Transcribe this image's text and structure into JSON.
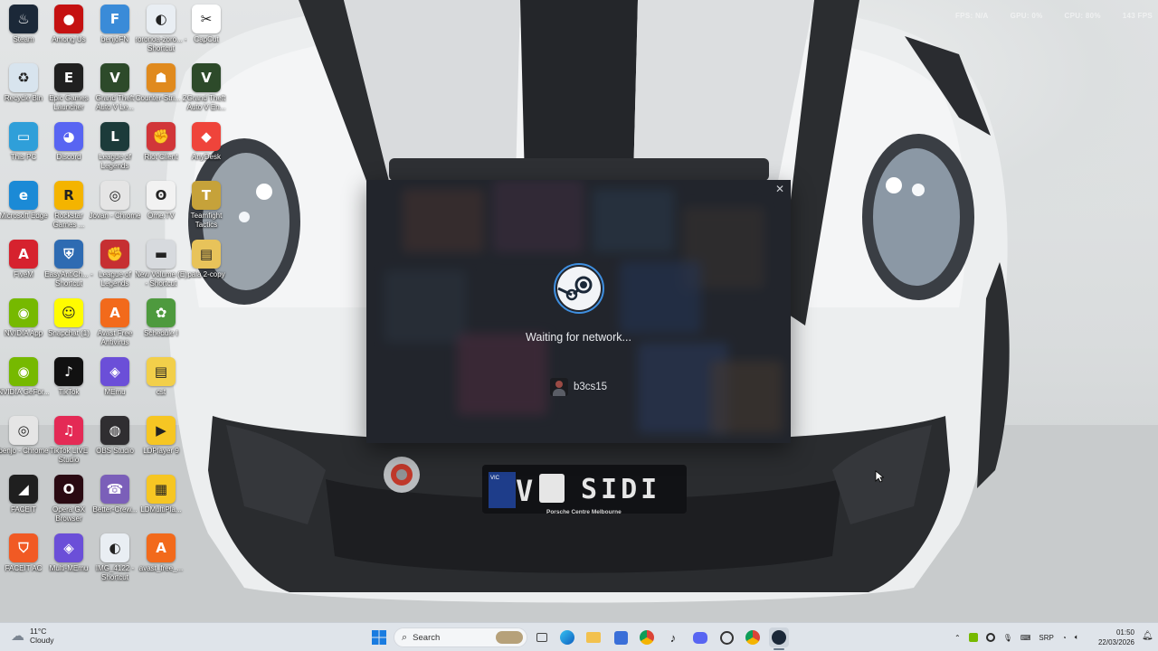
{
  "status_overlay": [
    "FPS: N/A",
    "GPU: 0%",
    "CPU: 80%",
    "143 FPS"
  ],
  "desktop_icons": [
    {
      "label": "Steam",
      "icon": "steam-icon",
      "color": "#1b2838",
      "glyph": "♨"
    },
    {
      "label": "Among Us",
      "icon": "among-us-icon",
      "color": "#c51111",
      "glyph": "●"
    },
    {
      "label": "benjoFN",
      "icon": "fortnite-icon",
      "color": "#3a8bd8",
      "glyph": "F"
    },
    {
      "label": "roronoa-zoro... - Shortcut",
      "icon": "image-shortcut-icon",
      "color": "#e9eef3",
      "glyph": "◐"
    },
    {
      "label": "CapCut",
      "icon": "capcut-icon",
      "color": "#ffffff",
      "glyph": "✂"
    },
    {
      "label": "Recycle Bin",
      "icon": "recycle-bin-icon",
      "color": "#d8e4ee",
      "glyph": "♻"
    },
    {
      "label": "Epic Games Launcher",
      "icon": "epic-games-icon",
      "color": "#202020",
      "glyph": "E"
    },
    {
      "label": "Grand Theft Auto V Le...",
      "icon": "gta-v-icon",
      "color": "#2d4a2a",
      "glyph": "V"
    },
    {
      "label": "Counter-Stri... 2",
      "icon": "counter-strike-icon",
      "color": "#e08a1e",
      "glyph": "☗"
    },
    {
      "label": "Grand Theft Auto V En...",
      "icon": "gta-v-enhanced-icon",
      "color": "#2d4a2a",
      "glyph": "V"
    },
    {
      "label": "This PC",
      "icon": "this-pc-icon",
      "color": "#2f9fd9",
      "glyph": "▭"
    },
    {
      "label": "Discord",
      "icon": "discord-icon",
      "color": "#5865f2",
      "glyph": "◕"
    },
    {
      "label": "League of Legends",
      "icon": "league-icon",
      "color": "#1c3b3a",
      "glyph": "L"
    },
    {
      "label": "Riot Client",
      "icon": "riot-client-icon",
      "color": "#d13639",
      "glyph": "✊"
    },
    {
      "label": "AnyDesk",
      "icon": "anydesk-icon",
      "color": "#ef443b",
      "glyph": "◆"
    },
    {
      "label": "Microsoft Edge",
      "icon": "edge-icon",
      "color": "#1b8ad6",
      "glyph": "e"
    },
    {
      "label": "Rockstar Games ...",
      "icon": "rockstar-icon",
      "color": "#f4b400",
      "glyph": "R"
    },
    {
      "label": "Jovan - Chrome",
      "icon": "chrome-icon",
      "color": "#e5e5e5",
      "glyph": "◎"
    },
    {
      "label": "Ome.TV",
      "icon": "ometv-icon",
      "color": "#f2f2f2",
      "glyph": "ʘ"
    },
    {
      "label": "Teamfight Tactics",
      "icon": "tft-icon",
      "color": "#c6a23a",
      "glyph": "T"
    },
    {
      "label": "FiveM",
      "icon": "fivem-icon",
      "color": "#d6222e",
      "glyph": "A"
    },
    {
      "label": "EasyAntiCh... - Shortcut",
      "icon": "easyanticheat-icon",
      "color": "#2e6bb2",
      "glyph": "⛨"
    },
    {
      "label": "League of Legends",
      "icon": "league-riot-icon",
      "color": "#c62f32",
      "glyph": "✊"
    },
    {
      "label": "New Volume (E) - Shortcut",
      "icon": "drive-icon",
      "color": "#d7dade",
      "glyph": "▬"
    },
    {
      "label": "pala 2-copy",
      "icon": "folder-icon",
      "color": "#e8c35a",
      "glyph": "▤"
    },
    {
      "label": "NVIDIA App",
      "icon": "nvidia-icon",
      "color": "#76b900",
      "glyph": "◉"
    },
    {
      "label": "Snapchat (1)",
      "icon": "snapchat-icon",
      "color": "#fffc00",
      "glyph": "☺"
    },
    {
      "label": "Avast Free Antivirus",
      "icon": "avast-icon",
      "color": "#f26a1b",
      "glyph": "A"
    },
    {
      "label": "Schedule I",
      "icon": "schedule-icon",
      "color": "#4e9a3e",
      "glyph": "✿"
    },
    {
      "label": "NVIDIA GeFor...",
      "icon": "geforce-icon",
      "color": "#76b900",
      "glyph": "◉"
    },
    {
      "label": "TikTok",
      "icon": "tiktok-icon",
      "color": "#111111",
      "glyph": "♪"
    },
    {
      "label": "MEmu",
      "icon": "memu-icon",
      "color": "#6b4fd8",
      "glyph": "◈"
    },
    {
      "label": "cst",
      "icon": "folder-icon",
      "color": "#f2cf4a",
      "glyph": "▤"
    },
    {
      "label": "benjo - Chrome",
      "icon": "chrome-icon",
      "color": "#e5e5e5",
      "glyph": "◎"
    },
    {
      "label": "TikTok LIVE Studio",
      "icon": "tiktok-live-icon",
      "color": "#e42a55",
      "glyph": "♫"
    },
    {
      "label": "OBS Studio",
      "icon": "obs-icon",
      "color": "#302e31",
      "glyph": "◍"
    },
    {
      "label": "LDPlayer 9",
      "icon": "ldplayer-icon",
      "color": "#f6c623",
      "glyph": "▶"
    },
    {
      "label": "FACEIT",
      "icon": "faceit-icon",
      "color": "#1f1f1f",
      "glyph": "◢"
    },
    {
      "label": "Opera GX Browser",
      "icon": "opera-gx-icon",
      "color": "#2a0a12",
      "glyph": "O"
    },
    {
      "label": "Better-Crew...",
      "icon": "better-crewlink-icon",
      "color": "#7b5fb9",
      "glyph": "☎"
    },
    {
      "label": "LDMultiPla...",
      "icon": "ldmultiplayer-icon",
      "color": "#f6c623",
      "glyph": "▦"
    },
    {
      "label": "FACEIT AC",
      "icon": "faceit-ac-icon",
      "color": "#f15a24",
      "glyph": "⛉"
    },
    {
      "label": "Multi-MEmu",
      "icon": "multi-memu-icon",
      "color": "#6b4fd8",
      "glyph": "◈"
    },
    {
      "label": "IMG_4122 - Shortcut",
      "icon": "image-shortcut-icon",
      "color": "#e9eef3",
      "glyph": "◐"
    },
    {
      "label": "avast_free_...",
      "icon": "avast-installer-icon",
      "color": "#f26a1b",
      "glyph": "A"
    }
  ],
  "plate": {
    "text": "V",
    "text2": "SIDI",
    "dealer": "Porsche Centre Melbourne",
    "state": "VIC"
  },
  "steam_dialog": {
    "close_glyph": "✕",
    "status": "Waiting for network...",
    "username": "b3cs15"
  },
  "taskbar": {
    "weather_temp": "11°C",
    "weather_desc": "Cloudy",
    "search_label": "Search",
    "language": "SRP",
    "time": "01:50",
    "date": "22/03/2026"
  },
  "colors": {
    "taskbar_bg": "#dfe4ea",
    "dialog_bg": "#2a2d34",
    "steam_ring": "#3f8fe0"
  }
}
